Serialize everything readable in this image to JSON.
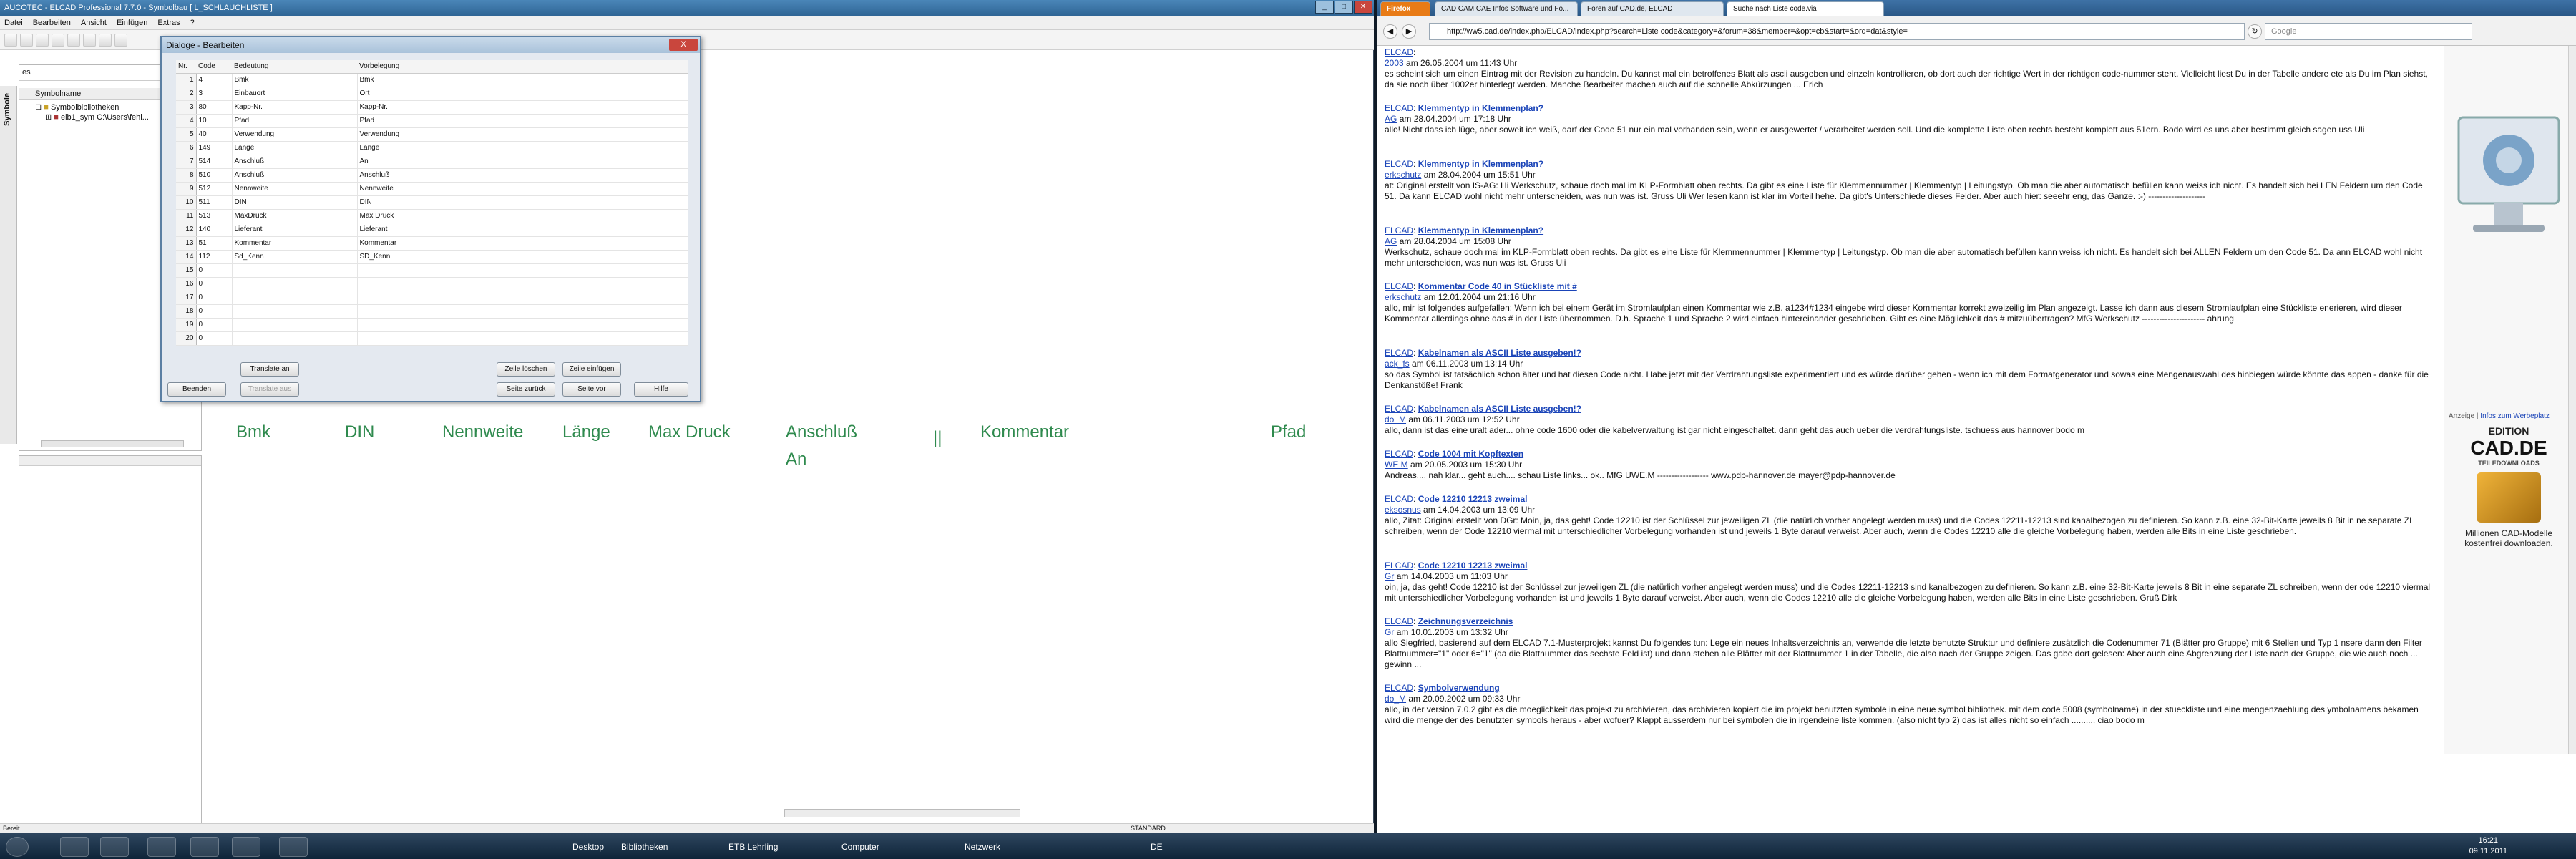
{
  "left_app": {
    "title": "AUCOTEC - ELCAD Professional 7.7.0 - Symbolbau [ L_SCHLAUCHLISTE ]",
    "menu": [
      "Datei",
      "Bearbeiten",
      "Ansicht",
      "Einfügen",
      "Extras",
      "?"
    ],
    "search_value": "es",
    "sidebar_tab_label": "Symbole",
    "tree_header": "Symbolname",
    "tree_items": [
      "Symbolbibliotheken",
      "elb1_sym   C:\\Users\\fehl..."
    ],
    "status_left": "Bereit",
    "status_right": "STANDARD",
    "canvas_labels": [
      "Bmk",
      "DIN",
      "Nennweite",
      "Länge",
      "Max Druck",
      "Anschluß",
      "An",
      "||",
      "Kommentar",
      "Pfad"
    ]
  },
  "dialog": {
    "title": "Dialoge - Bearbeiten",
    "close_label": "X",
    "columns": [
      "Nr.",
      "Code",
      "Bedeutung",
      "Vorbelegung"
    ],
    "rows": [
      {
        "nr": "1",
        "code": "4",
        "bedeutung": "Bmk",
        "vorbelegung": "Bmk"
      },
      {
        "nr": "2",
        "code": "3",
        "bedeutung": "Einbauort",
        "vorbelegung": "Ort"
      },
      {
        "nr": "3",
        "code": "80",
        "bedeutung": "Kapp-Nr.",
        "vorbelegung": "Kapp-Nr."
      },
      {
        "nr": "4",
        "code": "10",
        "bedeutung": "Pfad",
        "vorbelegung": "Pfad"
      },
      {
        "nr": "5",
        "code": "40",
        "bedeutung": "Verwendung",
        "vorbelegung": "Verwendung"
      },
      {
        "nr": "6",
        "code": "149",
        "bedeutung": "Länge",
        "vorbelegung": "Länge"
      },
      {
        "nr": "7",
        "code": "514",
        "bedeutung": "Anschluß",
        "vorbelegung": "An"
      },
      {
        "nr": "8",
        "code": "510",
        "bedeutung": "Anschluß",
        "vorbelegung": "Anschluß"
      },
      {
        "nr": "9",
        "code": "512",
        "bedeutung": "Nennweite",
        "vorbelegung": "Nennweite"
      },
      {
        "nr": "10",
        "code": "511",
        "bedeutung": "DIN",
        "vorbelegung": "DIN"
      },
      {
        "nr": "11",
        "code": "513",
        "bedeutung": "MaxDruck",
        "vorbelegung": "Max Druck"
      },
      {
        "nr": "12",
        "code": "140",
        "bedeutung": "Lieferant",
        "vorbelegung": "Lieferant"
      },
      {
        "nr": "13",
        "code": "51",
        "bedeutung": "Kommentar",
        "vorbelegung": "Kommentar"
      },
      {
        "nr": "14",
        "code": "112",
        "bedeutung": "Sd_Kenn",
        "vorbelegung": "SD_Kenn"
      },
      {
        "nr": "15",
        "code": "0",
        "bedeutung": "",
        "vorbelegung": ""
      },
      {
        "nr": "16",
        "code": "0",
        "bedeutung": "",
        "vorbelegung": ""
      },
      {
        "nr": "17",
        "code": "0",
        "bedeutung": "",
        "vorbelegung": ""
      },
      {
        "nr": "18",
        "code": "0",
        "bedeutung": "",
        "vorbelegung": ""
      },
      {
        "nr": "19",
        "code": "0",
        "bedeutung": "",
        "vorbelegung": ""
      },
      {
        "nr": "20",
        "code": "0",
        "bedeutung": "",
        "vorbelegung": ""
      }
    ],
    "buttons": {
      "translate_an": "Translate an",
      "zeile_loeschen": "Zeile löschen",
      "zeile_einfuegen": "Zeile einfügen",
      "beenden": "Beenden",
      "translate_aus": "Translate aus",
      "seite_zurueck": "Seite zurück",
      "seite_vor": "Seite vor",
      "hilfe": "Hilfe"
    }
  },
  "browser": {
    "tabs": [
      "Firefox",
      "CAD CAM CAE Infos Software und Fo...",
      "Foren auf CAD.de, ELCAD",
      "Suche nach Liste code.via"
    ],
    "url": "http://ww5.cad.de/index.php/ELCAD/index.php?search=Liste code&category=&forum=38&member=&opt=cb&start=&ord=dat&style=",
    "search_placeholder": "Google",
    "ad_label": "Anzeige",
    "ad_link": "Infos zum Werbeplatz",
    "ad_brand_line1": "EDITION",
    "ad_brand_line2": "CAD.DE",
    "ad_brand_line3": "TEILEDOWNLOADS",
    "ad_caption": "Millionen CAD-Modelle kostenfrei downloaden.",
    "results": [
      {
        "title": "",
        "meta": "am 26.05.2004 um 11:43 Uhr",
        "author": "2003",
        "text": "es scheint sich um einen Eintrag mit der Revision zu handeln. Du kannst mal ein betroffenes Blatt als ascii ausgeben und einzeln kontrollieren, ob dort auch der richtige Wert in der richtigen code-nummer steht. Vielleicht liest Du in der Tabelle andere ete als Du im Plan siehst, da sie noch über 1002er hinterlegt werden. Manche Bearbeiter machen auch auf die schnelle Abkürzungen ... Erich"
      },
      {
        "title": "Klemmentyp in Klemmenplan?",
        "meta": "am 28.04.2004 um 17:18 Uhr",
        "author": "AG",
        "text": "allo! Nicht dass ich lüge, aber soweit ich weiß, darf der Code 51 nur ein mal vorhanden sein, wenn er ausgewertet / verarbeitet werden soll. Und die komplette Liste oben rechts besteht komplett aus 51ern. Bodo wird es uns aber bestimmt gleich sagen uss Uli"
      },
      {
        "title": "Klemmentyp in Klemmenplan?",
        "meta": "am 28.04.2004 um 15:51 Uhr",
        "author": "erkschutz",
        "text": "at: Original erstellt von IS-AG: Hi Werkschutz, schaue doch mal im KLP-Formblatt oben rechts. Da gibt es eine Liste für Klemmennummer | Klemmentyp | Leitungstyp. Ob man die aber automatisch befüllen kann weiss ich nicht. Es handelt sich bei LEN Feldern um den Code 51. Da kann ELCAD wohl nicht mehr unterscheiden, was nun was ist. Gruss Uli Wer lesen kann ist klar im Vorteil hehe. Da gibt's Unterschiede dieses Felder. Aber auch hier: seeehr eng, das Ganze. :-) --------------------"
      },
      {
        "title": "Klemmentyp in Klemmenplan?",
        "meta": "am 28.04.2004 um 15:08 Uhr",
        "author": "AG",
        "text": "Werkschutz, schaue doch mal im KLP-Formblatt oben rechts. Da gibt es eine Liste für Klemmennummer | Klemmentyp | Leitungstyp. Ob man die aber automatisch befüllen kann weiss ich nicht. Es handelt sich bei ALLEN Feldern um den Code 51. Da ann ELCAD wohl nicht mehr unterscheiden, was nun was ist. Gruss Uli"
      },
      {
        "title": "Kommentar Code 40 in Stückliste mit #",
        "meta": "am 12.01.2004 um 21:16 Uhr",
        "author": "erkschutz",
        "text": "allo, mir ist folgendes aufgefallen: Wenn ich bei einem Gerät im Stromlaufplan einen Kommentar wie z.B. a1234#1234 eingebe wird dieser Kommentar korrekt zweizeilig im Plan angezeigt. Lasse ich dann aus diesem Stromlaufplan eine Stückliste enerieren, wird dieser Kommentar allerdings ohne das # in der Liste übernommen. D.h. Sprache 1 und Sprache 2 wird einfach hintereinander geschrieben. Gibt es eine Möglichkeit das # mitzuübertragen? MfG Werkschutz ---------------------- ahrung"
      },
      {
        "title": "Kabelnamen als ASCII Liste ausgeben!?",
        "meta": "am 06.11.2003 um 13:14 Uhr",
        "author": "ack_fs",
        "text": "so das Symbol ist tatsächlich schon älter und hat diesen Code nicht. Habe jetzt mit der Verdrahtungsliste experimentiert und es würde darüber gehen - wenn ich mit dem Formatgenerator und sowas eine Mengenauswahl des hinbiegen würde könnte das appen - danke für die Denkanstöße! Frank"
      },
      {
        "title": "Kabelnamen als ASCII Liste ausgeben!?",
        "meta": "am 06.11.2003 um 12:52 Uhr",
        "author": "do_M",
        "text": "allo, dann ist das eine uralt ader... ohne code 1600 oder die kabelverwaltung ist gar nicht eingeschaltet. dann geht das auch ueber die verdrahtungsliste. tschuess aus hannover bodo m"
      },
      {
        "title": "Code 1004 mit Kopftexten",
        "meta": "am 20.05.2003 um 15:30 Uhr",
        "author": "WE M",
        "text": "Andreas.... nah klar... geht auch.... schau Liste links... ok.. MfG UWE.M ------------------ www.pdp-hannover.de mayer@pdp-hannover.de"
      },
      {
        "title": "Code 12210 12213 zweimal",
        "meta": "am 14.04.2003 um 13:09 Uhr",
        "author": "eksosnus",
        "text": "allo, Zitat: Original erstellt von DGr: Moin, ja, das geht! Code 12210 ist der Schlüssel zur jeweiligen ZL (die natürlich vorher angelegt werden muss) und die Codes 12211-12213 sind kanalbezogen zu definieren. So kann z.B. eine 32-Bit-Karte jeweils 8 Bit in ne separate ZL schreiben, wenn der Code 12210 viermal mit unterschiedlicher Vorbelegung vorhanden ist und jeweils 1 Byte darauf verweist. Aber auch, wenn die Codes 12210 alle die gleiche Vorbelegung haben, werden alle Bits in eine Liste geschrieben."
      },
      {
        "title": "Code 12210 12213 zweimal",
        "meta": "am 14.04.2003 um 11:03 Uhr",
        "author": "Gr",
        "text": "oin, ja, das geht! Code 12210 ist der Schlüssel zur jeweiligen ZL (die natürlich vorher angelegt werden muss) und die Codes 12211-12213 sind kanalbezogen zu definieren. So kann z.B. eine 32-Bit-Karte jeweils 8 Bit in eine separate ZL schreiben, wenn der ode 12210 viermal mit unterschiedlicher Vorbelegung vorhanden ist und jeweils 1 Byte darauf verweist. Aber auch, wenn die Codes 12210 alle die gleiche Vorbelegung haben, werden alle Bits in eine Liste geschrieben. Gruß Dirk"
      },
      {
        "title": "Zeichnungsverzeichnis",
        "meta": "am 10.01.2003 um 13:32 Uhr",
        "author": "Gr",
        "text": "allo Siegfried, basierend auf dem ELCAD 7.1-Musterprojekt kannst Du folgendes tun: Lege ein neues Inhaltsverzeichnis an, verwende die letzte benutzte Struktur und definiere zusätzlich die Codenummer 71 (Blätter pro Gruppe) mit 6 Stellen und Typ 1 nsere dann den Filter Blattnummer=\"1\" oder 6=\"1\" (da die Blattnummer das sechste Feld ist) und dann stehen alle Blätter mit der Blattnummer 1 in der Tabelle, die also nach der Gruppe zeigen. Das gabe dort gelesen: Aber auch eine Abgrenzung der Liste nach der Gruppe, die wie auch noch ... gewinn ..."
      },
      {
        "title": "Symbolverwendung",
        "meta": "am 20.09.2002 um 09:33 Uhr",
        "author": "do_M",
        "text": "allo, in der version 7.0.2 gibt es die moeglichkeit das projekt zu archivieren, das archivieren kopiert die im projekt benutzten symbole in eine neue symbol bibliothek. mit dem code 5008 (symbolname) in der stueckliste und eine mengenzaehlung des ymbolnamens bekamen wird die menge der des benutzten symbols heraus - aber wofuer? Klappt ausserdem nur bei symbolen die in irgendeine liste kommen. (also nicht typ 2) das ist alles nicht so einfach .......... ciao bodo m"
      }
    ]
  },
  "taskbar": {
    "items": [
      "Desktop",
      "Bibliotheken",
      "ETB Lehrling",
      "Computer",
      "Netzwerk"
    ],
    "lang": "DE",
    "time": "16:21",
    "date": "09.11.2011"
  }
}
